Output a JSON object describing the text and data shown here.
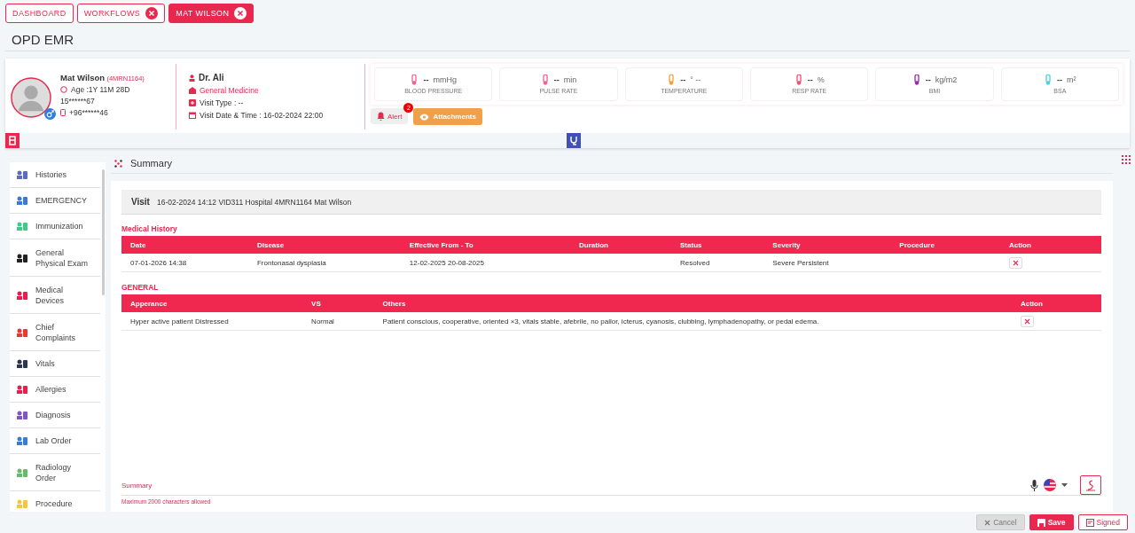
{
  "tabs": [
    {
      "label": "DASHBOARD",
      "selected": false,
      "closable": false
    },
    {
      "label": "WORKFLOWS",
      "selected": false,
      "closable": true
    },
    {
      "label": "MAT WILSON",
      "selected": true,
      "closable": true
    }
  ],
  "page_title": "OPD EMR",
  "patient": {
    "name": "Mat Wilson",
    "mrn": "(4MRN1164)",
    "age": "Age :1Y 11M 28D",
    "id": "15******67",
    "phone": "+96******46"
  },
  "doctor": {
    "name": "Dr. Ali",
    "department": "General Medicine",
    "visit_type": "Visit Type : --",
    "visit_date": "Visit Date & Time : 16-02-2024 22:00"
  },
  "vitals": [
    {
      "value": "--",
      "unit": "mmHg",
      "label": "BLOOD PRESSURE",
      "color": "#f06292"
    },
    {
      "value": "--",
      "unit": "min",
      "label": "PULSE RATE",
      "color": "#f06292"
    },
    {
      "value": "--",
      "unit": "° --",
      "label": "TEMPERATURE",
      "color": "#f0a040"
    },
    {
      "value": "--",
      "unit": "%",
      "label": "RESP RATE",
      "color": "#f0506e"
    },
    {
      "value": "--",
      "unit": "kg/m2",
      "label": "BMI",
      "color": "#9c27b0"
    },
    {
      "value": "--",
      "unit": "m²",
      "label": "BSA",
      "color": "#4dd0e1"
    }
  ],
  "alert": {
    "label": "Alert",
    "count": "2"
  },
  "attachments": {
    "label": "Attachments"
  },
  "sidebar": {
    "items": [
      {
        "label": "Histories",
        "color": "#5c6bc0"
      },
      {
        "label": "EMERGENCY",
        "color": "#3a7bd5"
      },
      {
        "label": "Immunization",
        "color": "#3ec98f"
      },
      {
        "label": "General Physical Exam",
        "color": "#222222"
      },
      {
        "label": "Medical Devices",
        "color": "#e91e4f"
      },
      {
        "label": "Chief Complaints",
        "color": "#e53935"
      },
      {
        "label": "Vitals",
        "color": "#2b3650"
      },
      {
        "label": "Allergies",
        "color": "#e91e4f"
      },
      {
        "label": "Diagnosis",
        "color": "#7e57c2"
      },
      {
        "label": "Lab Order",
        "color": "#3a7bd5"
      },
      {
        "label": "Radiology Order",
        "color": "#66bb6a"
      },
      {
        "label": "Procedure",
        "color": "#f5c542"
      }
    ]
  },
  "section_title": "Summary",
  "visit": {
    "label": "Visit",
    "text": "16-02-2024 14:12 VID311 Hospital 4MRN1164 Mat Wilson"
  },
  "medical_history": {
    "title": "Medical History",
    "columns": [
      "Date",
      "Disease",
      "Effective From - To",
      "Duration",
      "Status",
      "Severity",
      "Procedure",
      "Action"
    ],
    "rows": [
      [
        "07-01-2026 14:38",
        "Frontonasal dysplasia",
        "12-02-2025 20-08-2025",
        "",
        "Resolved",
        "Severe Persistent",
        ""
      ]
    ]
  },
  "general": {
    "title": "GENERAL",
    "columns": [
      "Apperance",
      "VS",
      "Others",
      "Action"
    ],
    "rows": [
      [
        "Hyper active patient Distressed",
        "Normal",
        "Patient conscious, cooperative, oriented ×3, vitals stable, afebrile, no pallor, icterus, cyanosis, clubbing, lymphadenopathy, or pedal edema."
      ]
    ]
  },
  "summary": {
    "placeholder": "Summary",
    "hint": "Maximum 2000 characters allowed"
  },
  "buttons": [
    {
      "label": "Cancel",
      "kind": "cancel"
    },
    {
      "label": "Save",
      "kind": "save"
    },
    {
      "label": "Signed",
      "kind": "signed"
    }
  ]
}
